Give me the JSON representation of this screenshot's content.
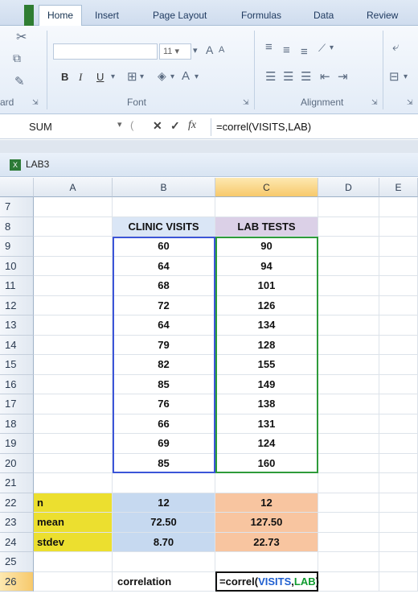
{
  "ribbon": {
    "tabs": [
      "Home",
      "Insert",
      "Page Layout",
      "Formulas",
      "Data",
      "Review"
    ],
    "active_tab": "Home",
    "font_size": "11",
    "groups": {
      "clipboard_fragment": "ard",
      "font": "Font",
      "alignment": "Alignment"
    },
    "font_buttons": {
      "bold": "B",
      "italic": "I",
      "underline": "U",
      "grow": "A",
      "shrink": "A",
      "color": "A"
    }
  },
  "formula_bar": {
    "name_box": "SUM",
    "cancel": "✕",
    "enter": "✓",
    "fx": "fx",
    "formula": "=correl(VISITS,LAB)"
  },
  "workbook": {
    "title": "LAB3"
  },
  "columns": [
    "A",
    "B",
    "C",
    "D",
    "E"
  ],
  "rows": [
    "7",
    "8",
    "9",
    "10",
    "11",
    "12",
    "13",
    "14",
    "15",
    "16",
    "17",
    "18",
    "19",
    "20",
    "21",
    "22",
    "23",
    "24",
    "25",
    "26"
  ],
  "table": {
    "headers": {
      "visits": "CLINIC VISITS",
      "lab": "LAB TESTS"
    },
    "visits": [
      "60",
      "64",
      "68",
      "72",
      "64",
      "79",
      "82",
      "85",
      "76",
      "66",
      "69",
      "85"
    ],
    "lab": [
      "90",
      "94",
      "101",
      "126",
      "134",
      "128",
      "155",
      "149",
      "138",
      "131",
      "124",
      "160"
    ]
  },
  "stats": {
    "labels": [
      "n",
      "mean",
      "stdev"
    ],
    "visits": [
      "12",
      "72.50",
      "8.70"
    ],
    "lab": [
      "12",
      "127.50",
      "22.73"
    ]
  },
  "correlation": {
    "label": "correlation",
    "prefix": "=correl(",
    "arg1": "VISITS",
    "comma": ",",
    "arg2": "LAB",
    "suffix": ")"
  },
  "colors": {
    "visits_header": "#dae6f6",
    "lab_header": "#dbd0e7",
    "stats_label": "#ecdf2f",
    "stats_visits": "#c6d9f0",
    "stats_lab": "#f8c5a0",
    "range_visits": "#3b55d8",
    "range_lab": "#2e9b3a"
  }
}
